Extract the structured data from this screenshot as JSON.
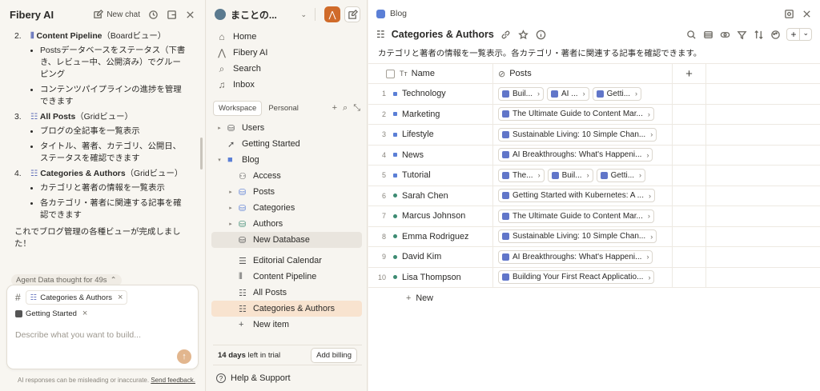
{
  "ai": {
    "title": "Fibery AI",
    "new_chat": "New chat",
    "sections": [
      {
        "num": "2.",
        "title": "Content Pipeline",
        "kind": "（Boardビュー）",
        "bullets": [
          "Postsデータベースをステータス（下書き、レビュー中、公開済み）でグルーピング",
          "コンテンツパイプラインの進捗を管理できます"
        ]
      },
      {
        "num": "3.",
        "title": "All Posts",
        "kind": "（Gridビュー）",
        "bullets": [
          "ブログの全記事を一覧表示",
          "タイトル、著者、カテゴリ、公開日、ステータスを確認できます"
        ]
      },
      {
        "num": "4.",
        "title": "Categories & Authors",
        "kind": "（Gridビュー）",
        "bullets": [
          "カテゴリと著者の情報を一覧表示",
          "各カテゴリ・著者に関連する記事を確認できます"
        ]
      }
    ],
    "final": "これでブログ管理の各種ビューが完成しました！",
    "thought": "Agent Data thought for 49s",
    "chip_categories": "Categories & Authors",
    "chip_started": "Getting Started",
    "placeholder": "Describe what you want to build...",
    "disclaimer": "AI responses can be misleading or inaccurate.",
    "feedback": "Send feedback."
  },
  "sidebar": {
    "workspace": "まことの...",
    "nav": [
      "Home",
      "Fibery AI",
      "Search",
      "Inbox"
    ],
    "tabs": [
      "Workspace",
      "Personal"
    ],
    "tree": [
      {
        "label": "Users",
        "caret": "▸",
        "indent": 0,
        "icon": "db"
      },
      {
        "label": "Getting Started",
        "caret": "",
        "indent": 0,
        "icon": "rocket"
      },
      {
        "label": "Blog",
        "caret": "▾",
        "indent": 0,
        "icon": "blog"
      },
      {
        "label": "Access",
        "caret": "",
        "indent": 1,
        "icon": "users"
      },
      {
        "label": "Posts",
        "caret": "▸",
        "indent": 1,
        "icon": "dbblue"
      },
      {
        "label": "Categories",
        "caret": "▸",
        "indent": 1,
        "icon": "dbblue"
      },
      {
        "label": "Authors",
        "caret": "▸",
        "indent": 1,
        "icon": "dbgreen"
      },
      {
        "label": "New Database",
        "caret": "",
        "indent": 1,
        "icon": "db",
        "state": "sel"
      },
      {
        "label": "",
        "caret": "",
        "indent": 1,
        "icon": "gap"
      },
      {
        "label": "Editorial Calendar",
        "caret": "",
        "indent": 1,
        "icon": "list"
      },
      {
        "label": "Content Pipeline",
        "caret": "",
        "indent": 1,
        "icon": "board"
      },
      {
        "label": "All Posts",
        "caret": "",
        "indent": 1,
        "icon": "grid"
      },
      {
        "label": "Categories & Authors",
        "caret": "",
        "indent": 1,
        "icon": "grid",
        "state": "active"
      },
      {
        "label": "New item",
        "caret": "",
        "indent": 1,
        "icon": "plus"
      }
    ],
    "trial_days": "14 days",
    "trial_rest": " left in trial",
    "billing": "Add billing",
    "help": "Help & Support"
  },
  "main": {
    "breadcrumb": "Blog",
    "view_title": "Categories & Authors",
    "description": "カテゴリと著者の情報を一覧表示。各カテゴリ・著者に関連する記事を確認できます。",
    "col_name": "Name",
    "col_posts": "Posts",
    "new_label": "New",
    "rows": [
      {
        "n": "1",
        "name": "Technology",
        "type": "cat",
        "posts": [
          "Buil...",
          "AI ...",
          "Getti..."
        ]
      },
      {
        "n": "2",
        "name": "Marketing",
        "type": "cat",
        "posts": [
          "The Ultimate Guide to Content Mar..."
        ]
      },
      {
        "n": "3",
        "name": "Lifestyle",
        "type": "cat",
        "posts": [
          "Sustainable Living: 10 Simple Chan..."
        ]
      },
      {
        "n": "4",
        "name": "News",
        "type": "cat",
        "posts": [
          "AI Breakthroughs: What's Happeni..."
        ]
      },
      {
        "n": "5",
        "name": "Tutorial",
        "type": "cat",
        "posts": [
          "The...",
          "Buil...",
          "Getti..."
        ]
      },
      {
        "n": "6",
        "name": "Sarah Chen",
        "type": "author",
        "posts": [
          "Getting Started with Kubernetes: A ..."
        ]
      },
      {
        "n": "7",
        "name": "Marcus Johnson",
        "type": "author",
        "posts": [
          "The Ultimate Guide to Content Mar..."
        ]
      },
      {
        "n": "8",
        "name": "Emma Rodriguez",
        "type": "author",
        "posts": [
          "Sustainable Living: 10 Simple Chan..."
        ]
      },
      {
        "n": "9",
        "name": "David Kim",
        "type": "author",
        "posts": [
          "AI Breakthroughs: What's Happeni..."
        ]
      },
      {
        "n": "10",
        "name": "Lisa Thompson",
        "type": "author",
        "posts": [
          "Building Your First React Applicatio..."
        ]
      }
    ]
  },
  "colors": {
    "accent": "#d06b2a",
    "post_icon": "#6176c9",
    "author_dot": "#3d8b72",
    "active_bg": "#f8e3cf"
  }
}
